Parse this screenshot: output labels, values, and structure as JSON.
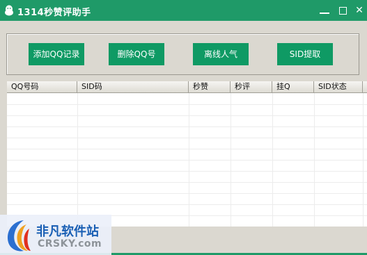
{
  "window": {
    "title": "1314秒赞评助手",
    "minimize": "minimize",
    "maximize": "maximize",
    "close": "✕"
  },
  "toolbar": {
    "add_label": "添加QQ记录",
    "delete_label": "删除QQ号",
    "offline_label": "离线人气",
    "sid_label": "SID提取"
  },
  "table": {
    "columns": [
      "QQ号码",
      "SID码",
      "秒赞",
      "秒评",
      "挂Q",
      "SID状态"
    ],
    "rows": []
  },
  "watermark": {
    "brand_cn": "非凡软件站",
    "brand_en": "CRSKY.com"
  },
  "colors": {
    "accent": "#1f9a68",
    "button": "#0f9a64",
    "client_bg": "#dbd8d0"
  },
  "icons": {
    "app": "qq-penguin-icon"
  }
}
